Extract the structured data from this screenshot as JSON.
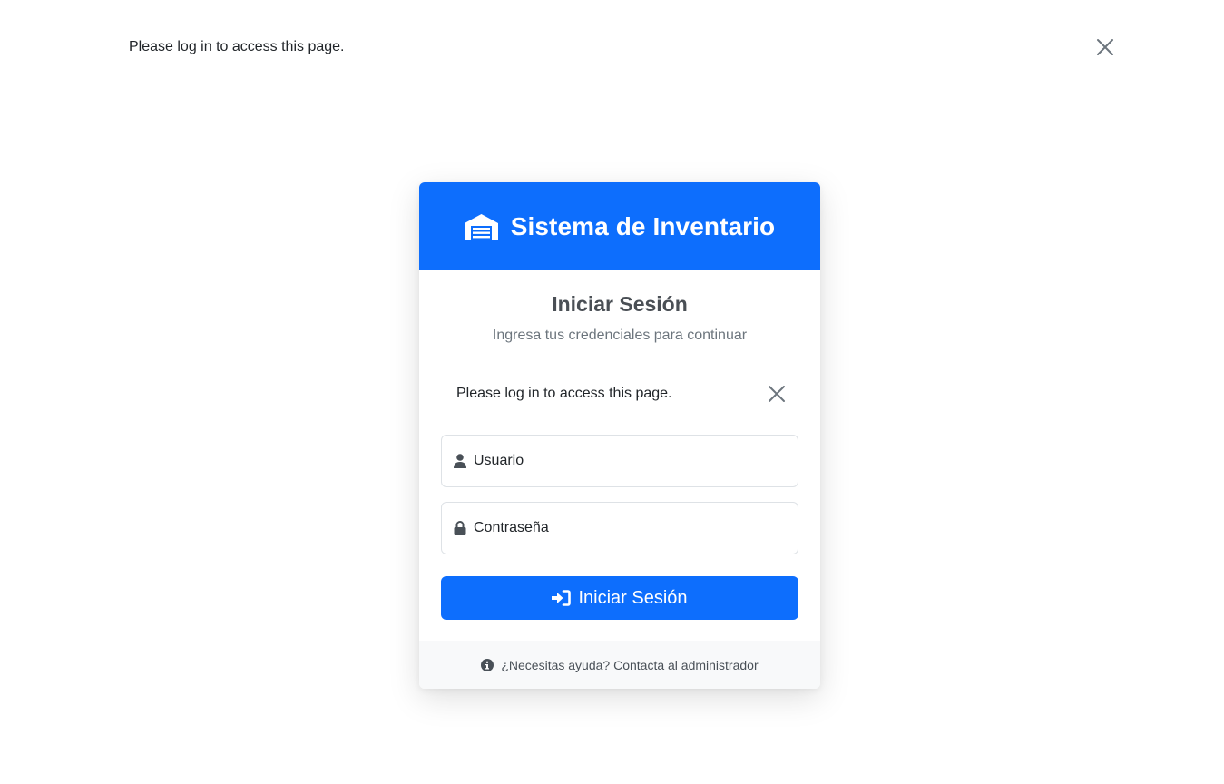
{
  "page_alert": {
    "message": "Please log in to access this page.",
    "close_icon": "close-icon"
  },
  "card": {
    "header": {
      "icon": "warehouse-icon",
      "title": "Sistema de Inventario",
      "background": "#0d6efd"
    },
    "title": "Iniciar Sesión",
    "subtitle": "Ingresa tus credenciales para continuar",
    "alert": {
      "message": "Please log in to access this page.",
      "close_icon": "close-icon"
    },
    "form": {
      "username": {
        "placeholder": "Usuario",
        "value": "",
        "icon": "user-icon"
      },
      "password": {
        "placeholder": "Contraseña",
        "value": "",
        "icon": "lock-icon"
      },
      "submit": {
        "label": "Iniciar Sesión",
        "icon": "sign-in-icon",
        "color": "#0d6efd"
      }
    },
    "footer": {
      "icon": "info-circle-icon",
      "text": "¿Necesitas ayuda? Contacta al administrador"
    }
  },
  "colors": {
    "primary": "#0d6efd",
    "footer_bg": "#f8f9fa",
    "field_border": "#dee2e6"
  }
}
